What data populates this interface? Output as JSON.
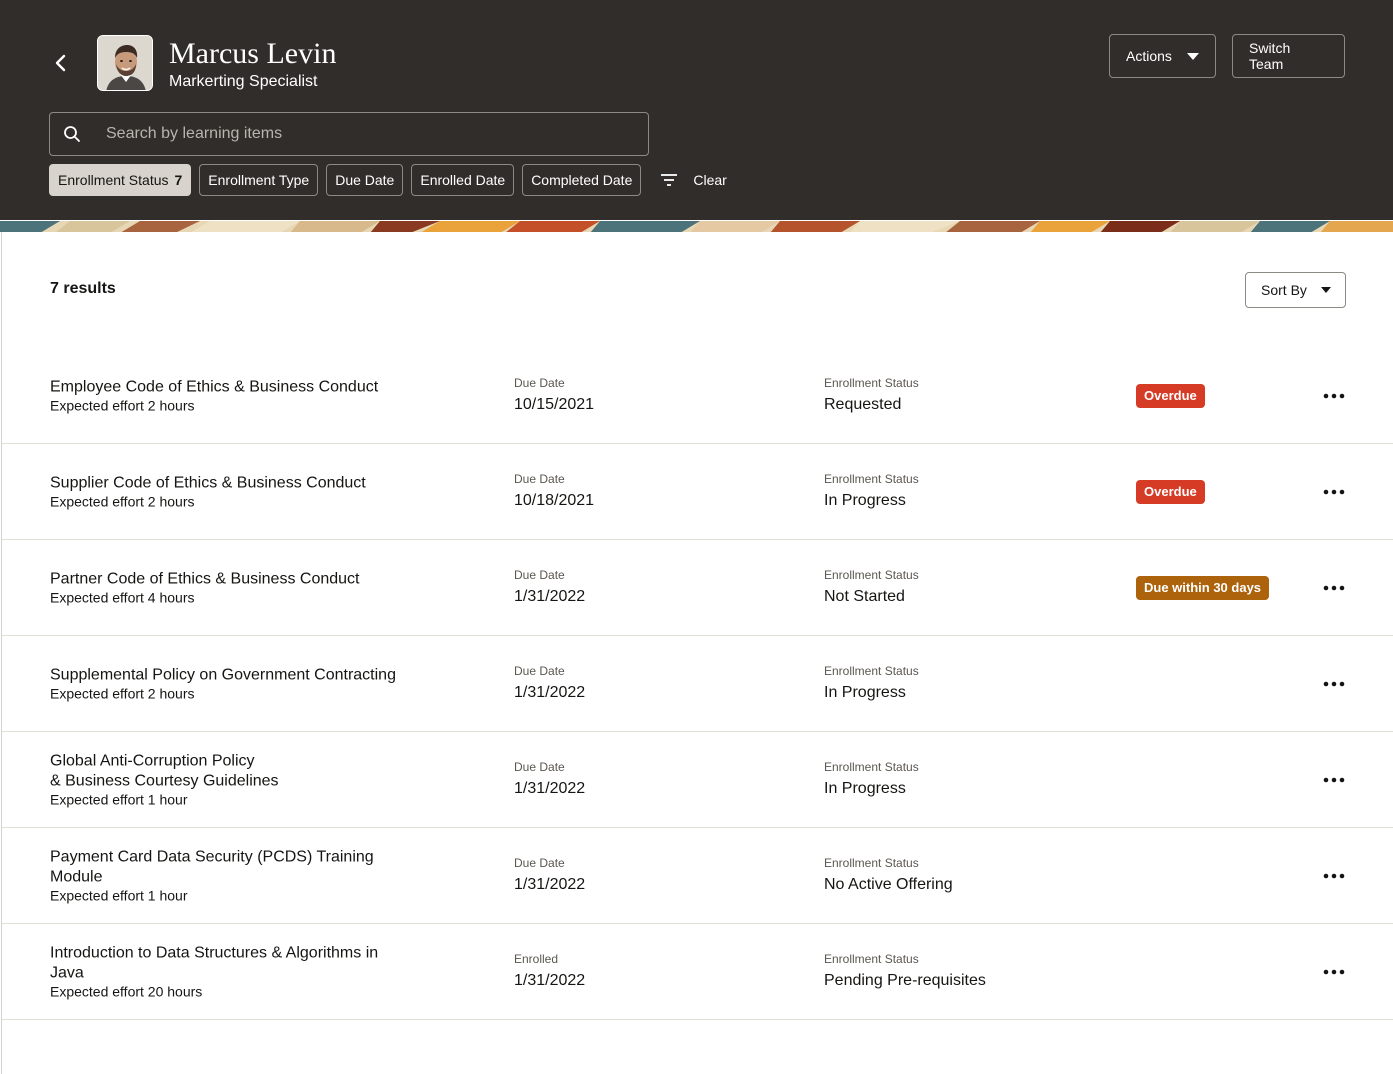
{
  "header": {
    "name": "Marcus Levin",
    "role": "Markerting Specialist",
    "actions_label": "Actions",
    "switch_team_label": "Switch Team",
    "search_placeholder": "Search by learning items",
    "clear_label": "Clear",
    "chips": [
      {
        "label": "Enrollment Status",
        "count": "7"
      },
      {
        "label": "Enrollment Type"
      },
      {
        "label": "Due Date"
      },
      {
        "label": "Enrolled Date"
      },
      {
        "label": "Completed Date"
      }
    ]
  },
  "main": {
    "results_label": "7 results",
    "sort_label": "Sort By",
    "items": [
      {
        "title": "Employee Code of Ethics & Business Conduct",
        "effort": "Expected effort 2 hours",
        "date_label": "Due Date",
        "date": "10/15/2021",
        "status_label": "Enrollment Status",
        "status": "Requested",
        "badge": "Overdue"
      },
      {
        "title": "Supplier Code of Ethics & Business Conduct",
        "effort": "Expected effort 2 hours",
        "date_label": "Due Date",
        "date": "10/18/2021",
        "status_label": "Enrollment Status",
        "status": "In Progress",
        "badge": "Overdue"
      },
      {
        "title": "Partner Code of Ethics & Business Conduct",
        "effort": "Expected effort 4 hours",
        "date_label": "Due Date",
        "date": "1/31/2022",
        "status_label": "Enrollment Status",
        "status": "Not Started",
        "badge": "Due within 30 days"
      },
      {
        "title": "Supplemental Policy on Government Contracting",
        "effort": "Expected effort 2 hours",
        "date_label": "Due Date",
        "date": "1/31/2022",
        "status_label": "Enrollment Status",
        "status": "In Progress"
      },
      {
        "title": "Global Anti-Corruption Policy\n& Business Courtesy Guidelines",
        "effort": "Expected effort 1 hour",
        "date_label": "Due Date",
        "date": "1/31/2022",
        "status_label": "Enrollment Status",
        "status": "In Progress"
      },
      {
        "title": "Payment Card Data Security (PCDS) Training Module",
        "effort": "Expected effort 1 hour",
        "date_label": "Due Date",
        "date": "1/31/2022",
        "status_label": "Enrollment Status",
        "status": "No Active Offering"
      },
      {
        "title": "Introduction to Data Structures & Algorithms in Java",
        "effort": "Expected effort 20 hours",
        "date_label": "Enrolled",
        "date": "1/31/2022",
        "status_label": "Enrollment Status",
        "status": "Pending Pre-requisites"
      }
    ]
  },
  "colors": {
    "header_bg": "#312d2a",
    "overdue": "#d63b25",
    "due_soon": "#ac630c"
  }
}
